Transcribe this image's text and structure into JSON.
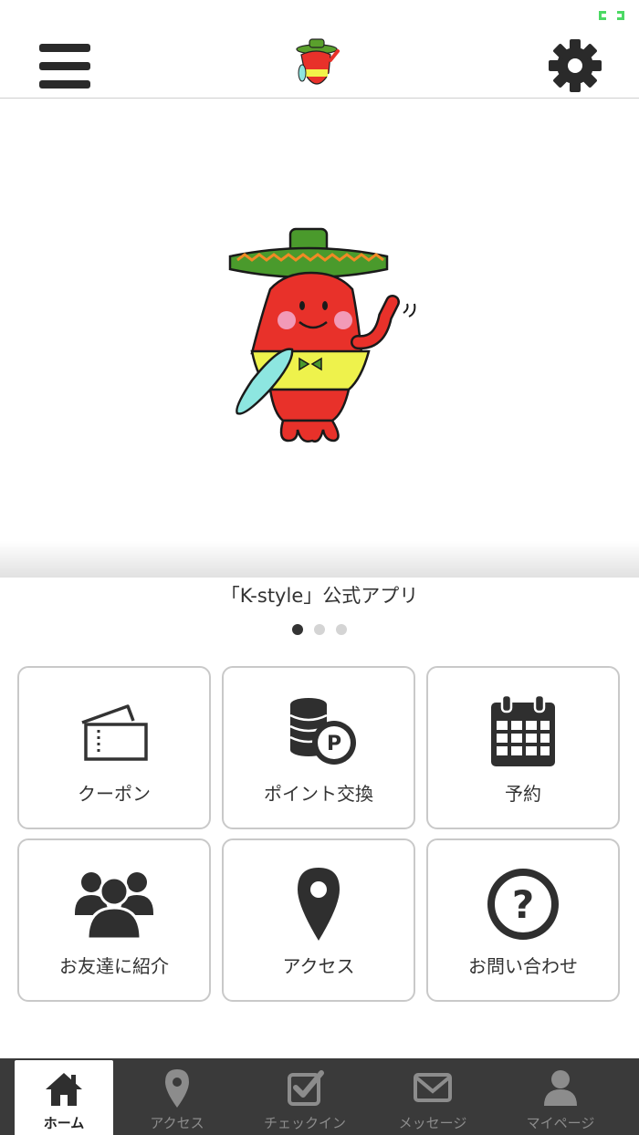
{
  "colors": {
    "accent_dark": "#333333",
    "tabbar_bg": "#3a3a3a",
    "border": "#c9c9c9",
    "battery": "#4cd964"
  },
  "header": {
    "menu_icon": "hamburger-icon",
    "logo_icon": "mascot-logo",
    "settings_icon": "gear-icon"
  },
  "hero": {
    "caption": "「K-style」公式アプリ",
    "slides_total": 3,
    "active_slide": 1
  },
  "menu": [
    {
      "label": "クーポン",
      "icon": "ticket-icon"
    },
    {
      "label": "ポイント交換",
      "icon": "coins-point-icon"
    },
    {
      "label": "予約",
      "icon": "calendar-icon"
    },
    {
      "label": "お友達に紹介",
      "icon": "people-icon"
    },
    {
      "label": "アクセス",
      "icon": "map-pin-icon"
    },
    {
      "label": "お問い合わせ",
      "icon": "question-icon"
    }
  ],
  "tabs": [
    {
      "label": "ホーム",
      "icon": "home-icon",
      "active": true
    },
    {
      "label": "アクセス",
      "icon": "map-pin-icon",
      "active": false
    },
    {
      "label": "チェックイン",
      "icon": "checkbox-icon",
      "active": false
    },
    {
      "label": "メッセージ",
      "icon": "mail-icon",
      "active": false
    },
    {
      "label": "マイページ",
      "icon": "user-icon",
      "active": false
    }
  ]
}
